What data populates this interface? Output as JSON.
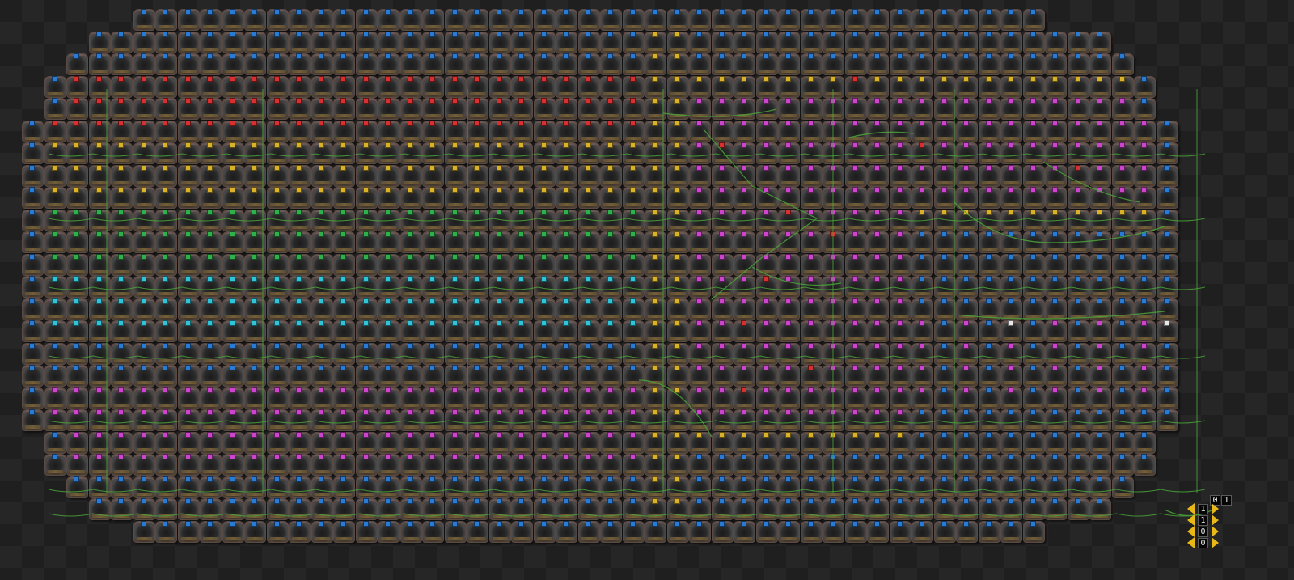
{
  "colors": {
    "blue": "#2a7bd4",
    "red": "#d83030",
    "yellow": "#d9b22a",
    "green": "#2fb04a",
    "cyan": "#30c4d8",
    "magenta": "#cc45cc",
    "white": "#e8e8e8",
    "wire": "#4aa33a"
  },
  "icons": {
    "lamp": "small-lamp-icon",
    "combinator": "arithmetic-combinator-icon",
    "wire": "green-circuit-wire-icon"
  },
  "display_panel": {
    "top_row": [
      "0",
      "1"
    ],
    "column": [
      "1",
      "1",
      "0",
      "0"
    ]
  }
}
